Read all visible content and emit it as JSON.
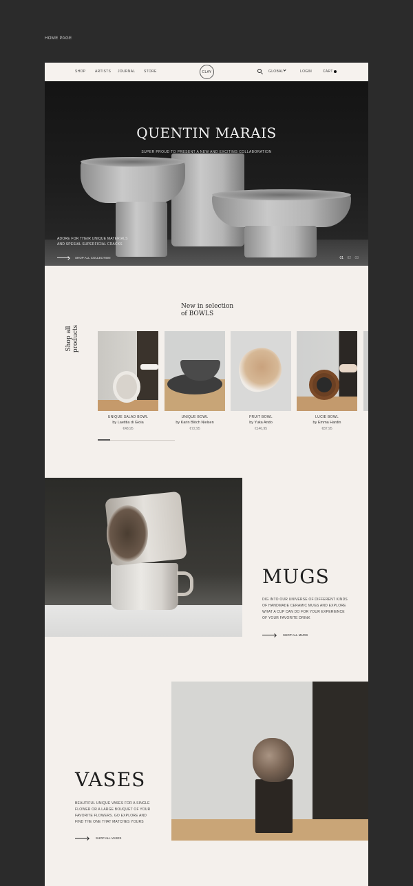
{
  "caption": "HOME PAGE",
  "nav": {
    "shop": "SHOP",
    "artists": "ARTISTS",
    "journal": "JOURNAL",
    "store": "STORE",
    "logo": "CLAY",
    "region": "GLOBAL",
    "login": "LOGIN",
    "cart": "CART"
  },
  "hero": {
    "title": "QUENTIN MARAIS",
    "subtitle": "SUPER PROUD TO PRESENT A NEW AND EXCITING COLLABORATION",
    "note_line1": "ADORE FOR THEIR UNIQUE MATERIALS",
    "note_line2": "AND SPESIAL SUPERFICIAL CRACKS",
    "cta": "SHOP ALL COLLECTION",
    "slides": [
      "01",
      "02",
      "03"
    ]
  },
  "selection": {
    "title_line1": "New in selection",
    "title_line2": "of BOWLS",
    "side_line1": "Shop all",
    "side_line2": "products",
    "products": [
      {
        "name": "UNIQUE SALAD BOWL",
        "artist": "by Laetitia di Gioia",
        "price": "€48,95"
      },
      {
        "name": "UNIQUE BOWL",
        "artist": "by Karin Blöch Nielsen",
        "price": "€72,95"
      },
      {
        "name": "FRUIT BOWL",
        "artist": "by Yuka Ando",
        "price": "€146,95"
      },
      {
        "name": "LUCIE BOWL",
        "artist": "by Emma Hardin",
        "price": "€87,95"
      }
    ]
  },
  "mugs": {
    "title": "MUGS",
    "text": "DIG INTO OUR UNIVERSE OF DIFFERENT KINDS OF HANDMADE CERAMIC MUGS AND EXPLORE WHAT A CUP CAN DO FOR YOUR EXPERIENCE OF YOUR FAVORITE DRINK",
    "cta": "SHOP ALL MUGS"
  },
  "vases": {
    "title": "VASES",
    "text": "BEAUTIFUL UNIQUE VASES FOR A SINGLE FLOWER OR A LARGE BOUQUET OF YOUR FAVORITE FLOWERS. GO EXPLORE AND FIND THE ONE THAT MATCHES YOURS",
    "cta": "SHOP ALL VASES"
  },
  "colors": {
    "page_bg": "#2b2b2b",
    "site_bg": "#f4f0ec",
    "text_dark": "#1e1e1e"
  }
}
